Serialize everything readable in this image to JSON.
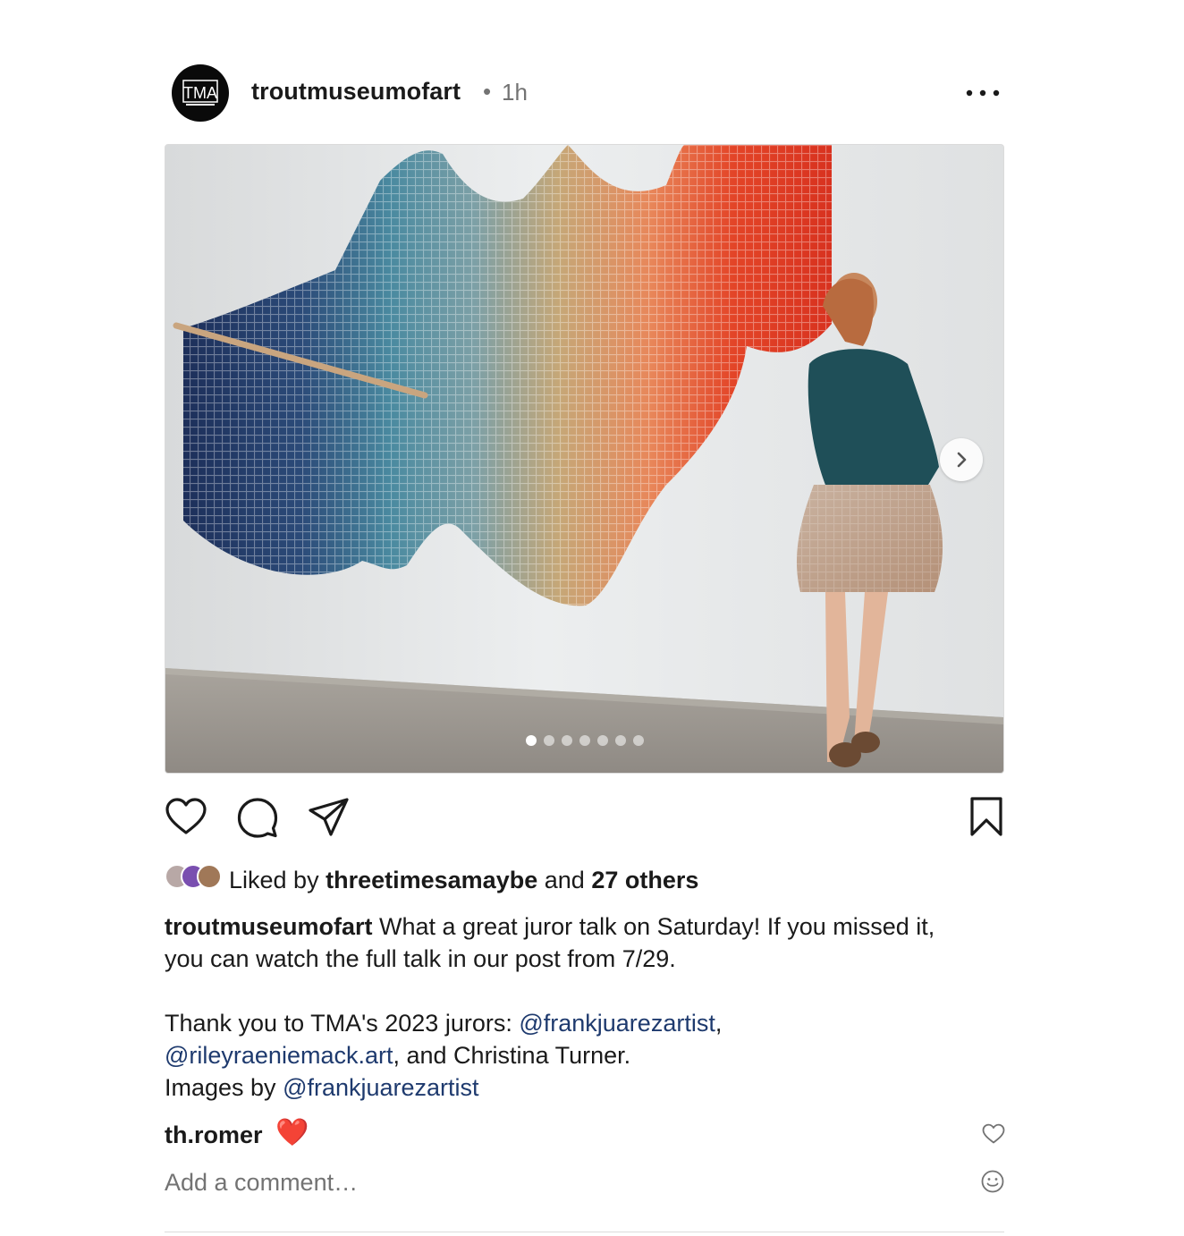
{
  "header": {
    "avatar_text": "TMA",
    "username": "troutmuseumofart",
    "separator": "•",
    "time": "1h",
    "more_icon": "more-horizontal-icon"
  },
  "media": {
    "carousel_count": 7,
    "active_index": 0,
    "next_icon": "chevron-right-icon"
  },
  "actions": {
    "like_icon": "heart-icon",
    "comment_icon": "comment-icon",
    "share_icon": "paper-plane-icon",
    "save_icon": "bookmark-icon"
  },
  "likes": {
    "prefix": "Liked by",
    "user": "threetimesamaybe",
    "conjunction": "and",
    "others": "27 others"
  },
  "caption": {
    "user": "troutmuseumofart",
    "line1": "What a great juror talk on Saturday! If you missed it,",
    "line2": "you can watch the full talk in our post from 7/29.",
    "line3_prefix": "Thank you to TMA's 2023 jurors: ",
    "mention1": "@frankjuarezartist",
    "line3_suffix": ",",
    "mention2": "@rileyraeniemack.art",
    "line4_suffix": ", and Christina Turner.",
    "line5_prefix": "Images by ",
    "mention3": "@frankjuarezartist"
  },
  "comment": {
    "user": "th.romer",
    "text": "❤️"
  },
  "add_comment": {
    "placeholder": "Add a comment…"
  },
  "colors": {
    "mention": "#1e3a6e",
    "muted": "#737373",
    "border": "#dbdbdb"
  }
}
